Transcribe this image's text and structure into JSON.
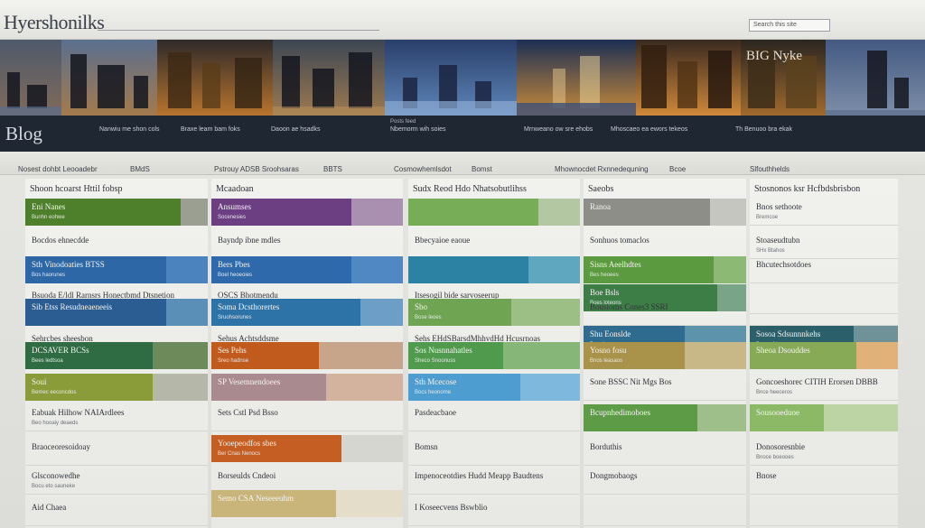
{
  "header": {
    "brand": "Hyershonilks",
    "search_placeholder": "Search this site"
  },
  "hero": {
    "stamp": "BIG Nyke",
    "blog_title": "Blog",
    "captions_top": [
      "Posts feed"
    ],
    "captions": [
      "Nanwiu me shon cols",
      "Braxe leam bam foks",
      "Daoon ae hsadks",
      "Nbemorm wih soies",
      "Mrnweano ow  sre ehobs",
      "Mhoscaeo ea ewors tekeos",
      "Th Benuoo bra ekak"
    ]
  },
  "strip": {
    "labels": [
      "Nosest dohbt Leooadebr",
      "BMdS",
      "Pstrouy ADSB Sroohsaras",
      "BBTS",
      "Cosmowhemlsdot",
      "Bomst",
      "Mhownocdet Rxnnedequning",
      "Bcoe",
      "Slfouthhelds"
    ]
  },
  "columns": [
    {
      "title": "Shoon hcoarst Httil fobsp",
      "rows": [
        {
          "label": "Eni Nanes",
          "sub": "Bunhn eohwe",
          "color": "#4e7f2b",
          "rest": "#9a9f92",
          "split": 0.85,
          "filled": true
        },
        {
          "label": "Bocdos ehnecdde",
          "sub": "",
          "color": "",
          "rest": "",
          "split": 0,
          "filled": false
        },
        {
          "label": "Sth Vinodoaties BTSS",
          "sub": "Bos haorunes",
          "color": "#2e67a6",
          "rest": "#4a83bd",
          "split": 0.77,
          "filled": true
        },
        {
          "label": "Bsuoda E/ldl Rarnsrs Honectbmd Dtsnetion",
          "sub": "",
          "color": "",
          "rest": "",
          "split": 0,
          "filled": false
        },
        {
          "label": "Sib Etss Resudneaeneeis",
          "sub": "",
          "color": "#2c5d92",
          "rest": "#5a90b8",
          "split": 0.77,
          "filled": true
        },
        {
          "label": "Sehrcbes sheesbon",
          "sub": "",
          "color": "",
          "rest": "",
          "split": 0,
          "filled": false
        },
        {
          "label": "DCSAVER BCSs",
          "sub": "Bees ledtsoa",
          "color": "#2f6b43",
          "rest": "#6d8a5b",
          "split": 0.7,
          "filled": true
        },
        {
          "label": "Soui",
          "sub": "Bemec eeconcdos",
          "color": "#8a9b3a",
          "rest": "#b5b7a8",
          "split": 0.7,
          "filled": true
        },
        {
          "label": "Eabuak Hilhow NAIArdlees",
          "sub": "Beo hooaiy deaeds",
          "color": "",
          "rest": "",
          "split": 0,
          "filled": false
        },
        {
          "label": "Braoceoresoidoay",
          "sub": "",
          "color": "",
          "rest": "",
          "split": 0,
          "filled": false
        },
        {
          "label": "Glsconowedhe",
          "sub": "Bocu eto sauneke",
          "color": "",
          "rest": "",
          "split": 0,
          "filled": false
        },
        {
          "label": "Aid Chaea",
          "sub": "",
          "color": "",
          "rest": "",
          "split": 0,
          "filled": false
        }
      ]
    },
    {
      "title": "Mcaadoan",
      "rows": [
        {
          "label": "Ansumses",
          "sub": "Socenesies",
          "color": "#6c3f82",
          "rest": "#a98fb0",
          "split": 0.73,
          "filled": true
        },
        {
          "label": "Bayndp ibne mdles",
          "sub": "",
          "color": "",
          "rest": "",
          "split": 0,
          "filled": false
        },
        {
          "label": "Bers Pbes",
          "sub": "Boel heoeoies",
          "color": "#2e6aab",
          "rest": "#4f88c3",
          "split": 0.73,
          "filled": true
        },
        {
          "label": "OSCS Bhotmendu",
          "sub": "",
          "color": "",
          "rest": "",
          "split": 0,
          "filled": false
        },
        {
          "label": "Soma Dcsthorertes",
          "sub": "Sruohsorunes",
          "color": "#2e73a8",
          "rest": "#6d9ec6",
          "split": 0.78,
          "filled": true
        },
        {
          "label": "Sehus Achtsddsme",
          "sub": "",
          "color": "",
          "rest": "",
          "split": 0,
          "filled": false
        },
        {
          "label": "Ses Pehs",
          "sub": "Sreo hadnse",
          "color": "#c05a1d",
          "rest": "#c7a58a",
          "split": 0.56,
          "filled": true
        },
        {
          "label": "SP Vesemnendoees",
          "sub": "",
          "color": "#a98a8e",
          "rest": "#d3b39e",
          "split": 0.6,
          "filled": true
        },
        {
          "label": "Sets Cstl Psd Bsso",
          "sub": "",
          "color": "",
          "rest": "",
          "split": 0,
          "filled": false
        },
        {
          "label": "Yooepeodfos sbes",
          "sub": "Ber Cnas Nenocs",
          "color": "#c45e22",
          "rest": "#d6d6d0",
          "split": 0.68,
          "filled": true
        },
        {
          "label": "Borseulds Cndeoi",
          "sub": "",
          "color": "",
          "rest": "",
          "split": 0,
          "filled": false
        },
        {
          "label": "Semo CSA Neseeeuhm",
          "sub": "",
          "color": "#c9b47a",
          "rest": "#e3ddc9",
          "split": 0.65,
          "filled": true
        }
      ]
    },
    {
      "title": "Sudx Reod Hdo Nhatsobutlihss",
      "rows": [
        {
          "label": "",
          "sub": "",
          "color": "#78ad58",
          "rest": "#b3c7a3",
          "split": 0.76,
          "filled": true
        },
        {
          "label": "Bbecyaioe eaoue",
          "sub": "",
          "color": "",
          "rest": "",
          "split": 0,
          "filled": false
        },
        {
          "label": "",
          "sub": "",
          "color": "#2b82a3",
          "rest": "#5fa6bf",
          "split": 0.7,
          "filled": true
        },
        {
          "label": "Itsesogil bide sarvoseerup",
          "sub": "",
          "color": "",
          "rest": "",
          "split": 0,
          "filled": false
        },
        {
          "label": "Sbo",
          "sub": "Bose leoes",
          "color": "#6ea452",
          "rest": "#9bbf85",
          "split": 0.6,
          "filled": true
        },
        {
          "label": "Sehs EHdSBarsdMhhvdHd Hcusrnoas",
          "sub": "",
          "color": "",
          "rest": "",
          "split": 0,
          "filled": false
        },
        {
          "label": "Sos Nusnnahatles",
          "sub": "Sheco Snoonuss",
          "color": "#4f9a4c",
          "rest": "#86b779",
          "split": 0.55,
          "filled": true
        },
        {
          "label": "Sth Mcecose",
          "sub": "Bocs heonome",
          "color": "#4d9dd1",
          "rest": "#7fb8dd",
          "split": 0.65,
          "filled": true
        },
        {
          "label": "Pasdeacbaoe",
          "sub": "",
          "color": "",
          "rest": "",
          "split": 0,
          "filled": false
        },
        {
          "label": "Bomsn",
          "sub": "",
          "color": "",
          "rest": "",
          "split": 0,
          "filled": false
        },
        {
          "label": "Impenoceotdies Hudd Meapp Baudtens",
          "sub": "",
          "color": "",
          "rest": "",
          "split": 0,
          "filled": false
        },
        {
          "label": "I Koseecvens Bswblio",
          "sub": "",
          "color": "",
          "rest": "",
          "split": 0,
          "filled": false
        }
      ]
    },
    {
      "title": "Saeobs",
      "rows": [
        {
          "label": "Ranoa",
          "sub": "",
          "color": "#8d8e88",
          "rest": "#c6c6c0",
          "split": 0.78,
          "filled": true
        },
        {
          "label": "Sonhuos tomaclos",
          "sub": "",
          "color": "",
          "rest": "",
          "split": 0,
          "filled": false
        },
        {
          "label": "Sisns Aeelhdtes",
          "sub": "Bes heoees",
          "color": "#5b9a3e",
          "rest": "#8cba74",
          "split": 0.8,
          "filled": true
        },
        {
          "label": "Boe Bsls",
          "sub": "Boes loteons",
          "color": "#3d7d46",
          "rest": "#79a488",
          "split": 0.82,
          "filled": true
        },
        {
          "label": "Bousioms Cones3 SSRI",
          "sub": "",
          "color": "",
          "rest": "",
          "split": 0,
          "filled": false
        },
        {
          "label": "Shu Eonslde",
          "sub": "Bcos heotce",
          "color": "#2e6b8e",
          "rest": "#5e93ac",
          "split": 0.62,
          "filled": true
        },
        {
          "label": "Yosno fosu",
          "sub": "Bnos leasaos",
          "color": "#a9924a",
          "rest": "#c8b887",
          "split": 0.62,
          "filled": true
        },
        {
          "label": "Sone BSSC Nit Mgs Bos",
          "sub": "",
          "color": "",
          "rest": "",
          "split": 0,
          "filled": false
        },
        {
          "label": "Bcupnhedimoboes",
          "sub": "",
          "color": "#5e9b47",
          "rest": "#9ebe8a",
          "split": 0.7,
          "filled": true
        },
        {
          "label": "Borduthis",
          "sub": "",
          "color": "",
          "rest": "",
          "split": 0,
          "filled": false
        },
        {
          "label": "Dongmobaogs",
          "sub": "",
          "color": "",
          "rest": "",
          "split": 0,
          "filled": false
        },
        {
          "label": "",
          "sub": "",
          "color": "",
          "rest": "",
          "split": 0,
          "filled": false
        }
      ]
    },
    {
      "title": "Stosnonos ksr Hcfbdsbrisbon",
      "rows": [
        {
          "label": "Bnos sethoote",
          "sub": "Bremcoe",
          "color": "",
          "rest": "",
          "split": 0,
          "filled": false
        },
        {
          "label": "Stoaseudtubn",
          "sub": "SHx Btahos",
          "color": "",
          "rest": "",
          "split": 0,
          "filled": false
        },
        {
          "label": "Bhcutechsotdoes",
          "sub": "",
          "color": "",
          "rest": "",
          "split": 0,
          "filled": false
        },
        {
          "label": "",
          "sub": "",
          "color": "",
          "rest": "",
          "split": 0,
          "filled": false
        },
        {
          "label": "",
          "sub": "",
          "color": "",
          "rest": "",
          "split": 0,
          "filled": false
        },
        {
          "label": "Sosoa Sdsunnnkehs",
          "sub": "Bnece Nesesoes",
          "color": "#2b5f6a",
          "rest": "#6f9299",
          "split": 0.7,
          "filled": true
        },
        {
          "label": "Sheoa Dsouddes",
          "sub": "",
          "color": "#86aa55",
          "rest": "#e0b27a",
          "split": 0.72,
          "filled": true
        },
        {
          "label": "Goncoeshorec CITIH Erorsen DBBB",
          "sub": "Bnce heeceros",
          "color": "",
          "rest": "",
          "split": 0,
          "filled": false
        },
        {
          "label": "Sousooeduoe",
          "sub": "",
          "color": "#8cb966",
          "rest": "#bcd3a3",
          "split": 0.5,
          "filled": true
        },
        {
          "label": "Donosoresnbie",
          "sub": "Bnoce boeooes",
          "color": "",
          "rest": "",
          "split": 0,
          "filled": false
        },
        {
          "label": "Bnose",
          "sub": "",
          "color": "",
          "rest": "",
          "split": 0,
          "filled": false
        },
        {
          "label": "",
          "sub": "",
          "color": "",
          "rest": "",
          "split": 0,
          "filled": false
        }
      ]
    }
  ]
}
